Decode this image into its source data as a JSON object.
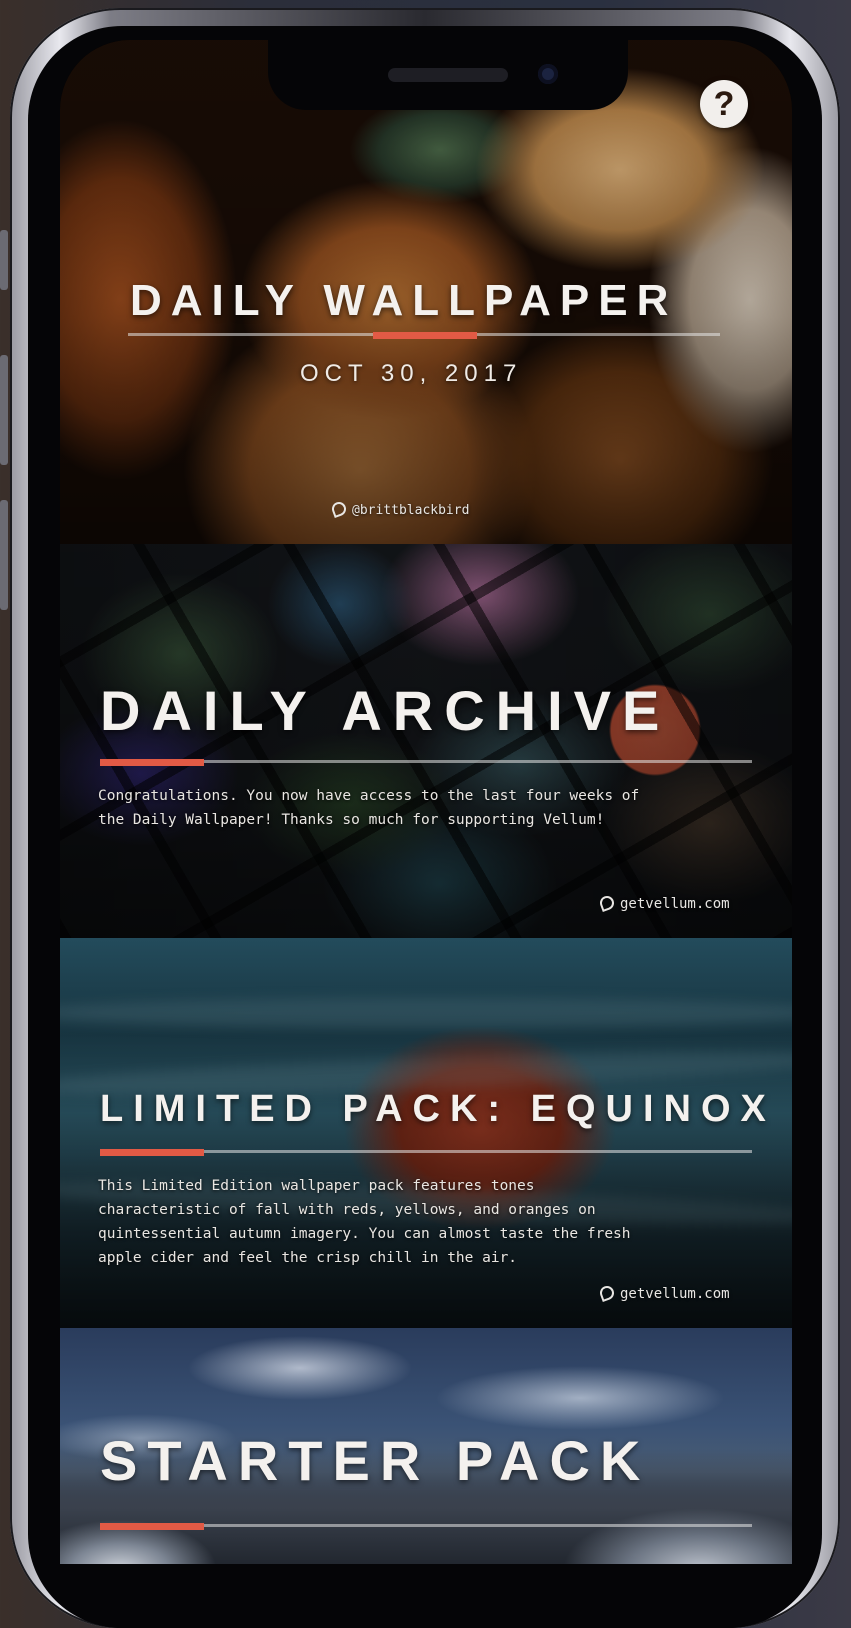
{
  "help_button": {
    "icon": "question-icon",
    "label": "?"
  },
  "cards": [
    {
      "title": "DAILY WALLPAPER",
      "date": "OCT 30, 2017",
      "credit": "@brittblackbird"
    },
    {
      "title": "DAILY ARCHIVE",
      "description": "Congratulations. You now have access to the last four weeks of\nthe Daily Wallpaper! Thanks so much for supporting Vellum!",
      "credit": "getvellum.com"
    },
    {
      "title": "LIMITED PACK: EQUINOX",
      "description": "This Limited Edition wallpaper pack features tones\ncharacteristic of fall with reds, yellows, and oranges on\nquintessential autumn imagery. You can almost taste the fresh\napple cider and feel the crisp chill in the air.",
      "credit": "getvellum.com"
    },
    {
      "title": "STARTER PACK"
    }
  ],
  "colors": {
    "accent": "#e25a45"
  }
}
